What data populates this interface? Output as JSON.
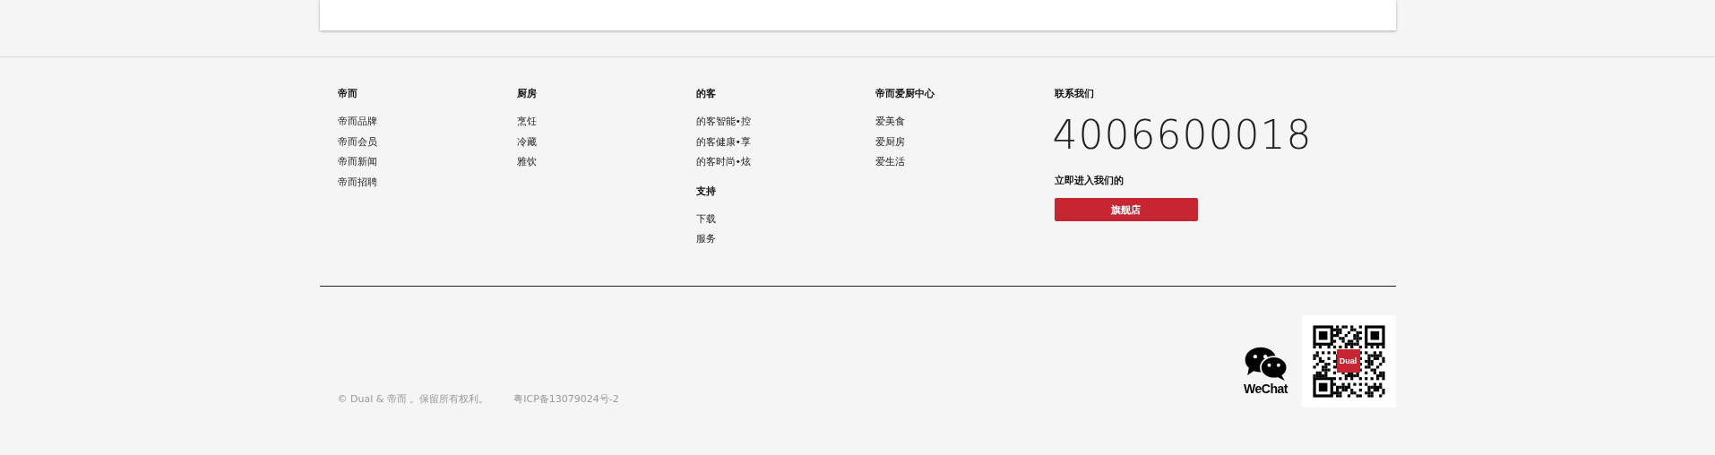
{
  "columns": [
    {
      "sections": [
        {
          "title": "帝而",
          "links": [
            "帝而品牌",
            "帝而会员",
            "帝而新闻",
            "帝而招聘"
          ]
        }
      ]
    },
    {
      "sections": [
        {
          "title": "厨房",
          "links": [
            "烹饪",
            "冷藏",
            "雅饮"
          ]
        }
      ]
    },
    {
      "sections": [
        {
          "title": "的客",
          "links": [
            "的客智能•控",
            "的客健康•享",
            "的客时尚•炫"
          ]
        },
        {
          "title": "支持",
          "links": [
            "下载",
            "服务"
          ]
        }
      ]
    },
    {
      "sections": [
        {
          "title": "帝而爱厨中心",
          "links": [
            "爱美食",
            "爱厨房",
            "爱生活"
          ]
        }
      ]
    }
  ],
  "contact": {
    "title": "联系我们",
    "phone": "4006600018",
    "store_label": "立即进入我们的",
    "store_button": "旗舰店"
  },
  "copyright": "© Dual & 帝而 。保留所有权利。",
  "icp": "粤ICP备13079024号-2",
  "wechat_label": "WeChat",
  "qr_logo": "Dual"
}
